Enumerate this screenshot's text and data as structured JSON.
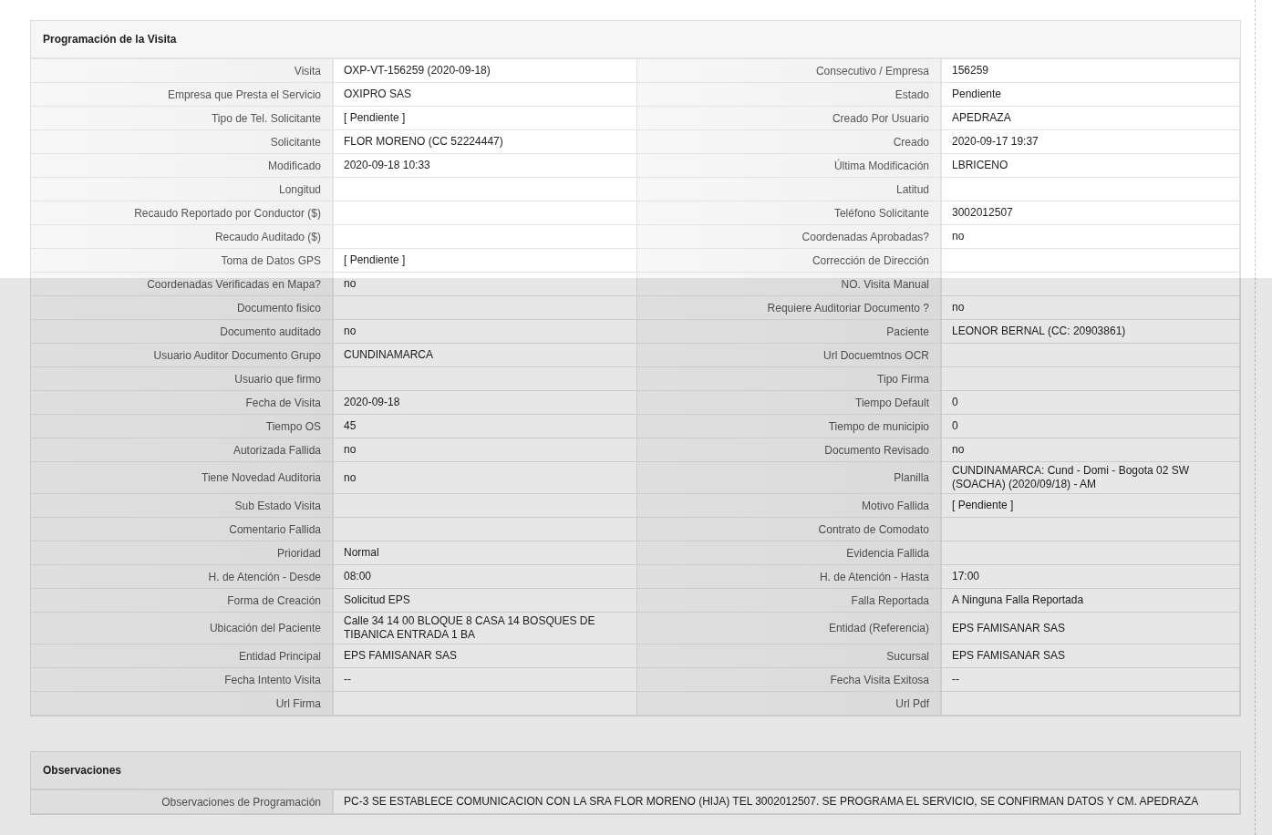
{
  "sections": [
    {
      "title": "Programación de la Visita",
      "rows": [
        [
          {
            "label": "Visita",
            "value": "OXP-VT-156259 (2020-09-18)"
          },
          {
            "label": "Consecutivo / Empresa",
            "value": "156259"
          }
        ],
        [
          {
            "label": "Empresa que Presta el Servicio",
            "value": "OXIPRO SAS"
          },
          {
            "label": "Estado",
            "value": "Pendiente"
          }
        ],
        [
          {
            "label": "Tipo de Tel. Solicitante",
            "value": "[ Pendiente ]"
          },
          {
            "label": "Creado Por Usuario",
            "value": "APEDRAZA"
          }
        ],
        [
          {
            "label": "Solicitante",
            "value": "FLOR MORENO (CC 52224447)"
          },
          {
            "label": "Creado",
            "value": "2020-09-17 19:37"
          }
        ],
        [
          {
            "label": "Modificado",
            "value": "2020-09-18 10:33"
          },
          {
            "label": "Última Modificación",
            "value": "LBRICENO"
          }
        ],
        [
          {
            "label": "Longitud"
          },
          {
            "label": "Latitud"
          }
        ],
        [
          {
            "label": "Recaudo Reportado por Conductor ($)"
          },
          {
            "label": "Teléfono Solicitante",
            "value": "3002012507"
          }
        ],
        [
          {
            "label": "Recaudo Auditado ($)"
          },
          {
            "label": "Coordenadas Aprobadas?",
            "value": "no"
          }
        ],
        [
          {
            "label": "Toma de Datos GPS",
            "value": "[ Pendiente ]"
          },
          {
            "label": "Corrección de Dirección"
          }
        ],
        [
          {
            "label": "Coordenadas Verificadas en Mapa?",
            "value": "no"
          },
          {
            "label": "NO. Visita Manual"
          }
        ],
        [
          {
            "label": "Documento fisico"
          },
          {
            "label": "Requiere Auditoriar Documento ?",
            "value": "no"
          }
        ],
        [
          {
            "label": "Documento auditado",
            "value": "no"
          },
          {
            "label": "Paciente",
            "value": "LEONOR BERNAL (CC: 20903861)"
          }
        ],
        [
          {
            "label": "Usuario Auditor Documento Grupo",
            "value": "CUNDINAMARCA"
          },
          {
            "label": "Url Docuemtnos OCR"
          }
        ],
        [
          {
            "label": "Usuario que firmo"
          },
          {
            "label": "Tipo Firma"
          }
        ],
        [
          {
            "label": "Fecha de Visita",
            "value": "2020-09-18"
          },
          {
            "label": "Tiempo Default",
            "value": "0"
          }
        ],
        [
          {
            "label": "Tiempo OS",
            "value": "45"
          },
          {
            "label": "Tiempo de municipio",
            "value": "0"
          }
        ],
        [
          {
            "label": "Autorizada Fallida",
            "value": "no"
          },
          {
            "label": "Documento Revisado",
            "value": "no"
          }
        ],
        [
          {
            "label": "Tiene Novedad Auditoria",
            "value": "no"
          },
          {
            "label": "Planilla",
            "value": "CUNDINAMARCA: Cund - Domi - Bogota 02 SW (SOACHA) (2020/09/18) - AM"
          }
        ],
        [
          {
            "label": "Sub Estado Visita"
          },
          {
            "label": "Motivo Fallida",
            "value": "[ Pendiente ]"
          }
        ],
        [
          {
            "label": "Comentario Fallida"
          },
          {
            "label": "Contrato de Comodato"
          }
        ],
        [
          {
            "label": "Prioridad",
            "value": "Normal"
          },
          {
            "label": "Evidencia Fallida"
          }
        ],
        [
          {
            "label": "H. de Atención - Desde",
            "value": "08:00"
          },
          {
            "label": "H. de Atención - Hasta",
            "value": "17:00"
          }
        ],
        [
          {
            "label": "Forma de Creación",
            "value": "Solicitud EPS"
          },
          {
            "label": "Falla Reportada",
            "value": "A Ninguna Falla Reportada"
          }
        ],
        [
          {
            "label": "Ubicación del Paciente",
            "value": "Calle 34 14 00 BLOQUE 8 CASA 14 BOSQUES DE TIBANICA ENTRADA 1 BA"
          },
          {
            "label": "Entidad (Referencia)",
            "value": "EPS FAMISANAR SAS"
          }
        ],
        [
          {
            "label": "Entidad Principal",
            "value": "EPS FAMISANAR SAS"
          },
          {
            "label": "Sucursal",
            "value": "EPS FAMISANAR SAS"
          }
        ],
        [
          {
            "label": "Fecha Intento Visita",
            "value": "--"
          },
          {
            "label": "Fecha Visita Exitosa",
            "value": "--"
          }
        ],
        [
          {
            "label": "Url Firma"
          },
          {
            "label": "Url Pdf"
          }
        ]
      ]
    },
    {
      "title": "Observaciones",
      "rows": [
        [
          {
            "label": "Observaciones de Programación",
            "value": "PC-3 SE ESTABLECE COMUNICACION CON LA SRA FLOR MORENO (HIJA) TEL 3002012507. SE PROGRAMA EL SERVICIO, SE CONFIRMAN DATOS Y CM. APEDRAZA"
          }
        ]
      ]
    }
  ]
}
